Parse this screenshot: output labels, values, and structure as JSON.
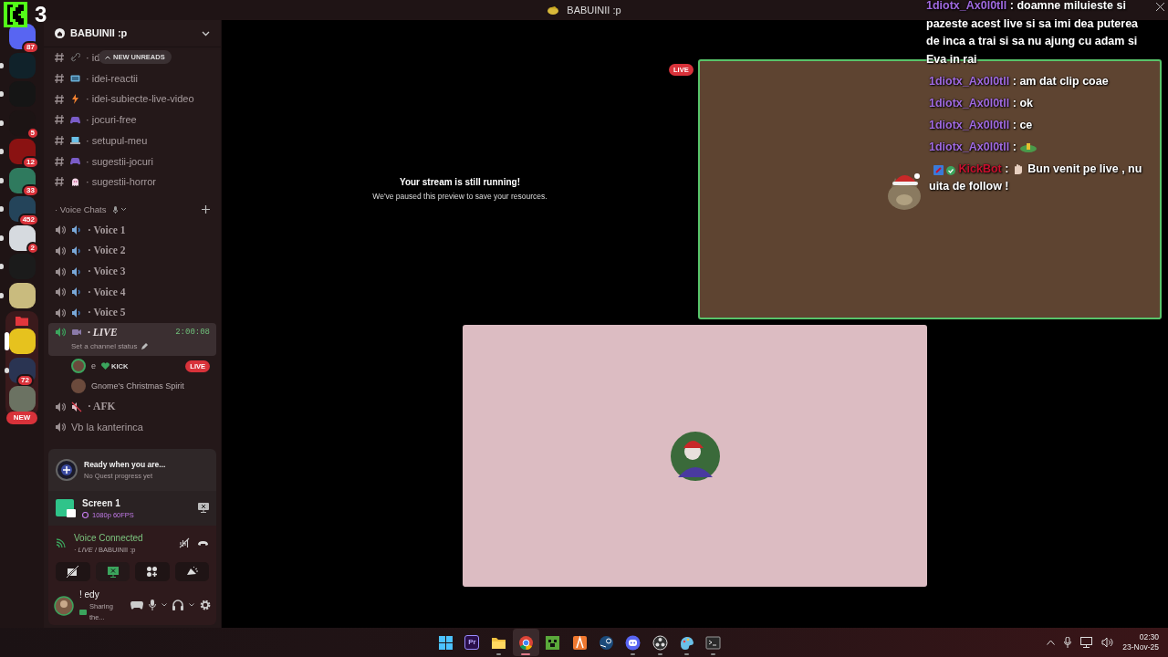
{
  "title_bar": {
    "title": "BABUINII :p"
  },
  "stream_logo": {
    "count": "3"
  },
  "servers": [
    {
      "badge": "87",
      "unread": false,
      "color": "#5865f2"
    },
    {
      "unread": true,
      "color": "#10222a"
    },
    {
      "unread": true,
      "color": "#151515"
    },
    {
      "badge": "5",
      "unread": true,
      "color": "#1c1414"
    },
    {
      "badge": "12",
      "unread": true,
      "color": "#8a1212"
    },
    {
      "badge": "33",
      "unread": true,
      "color": "#2f7a5e"
    },
    {
      "badge": "452",
      "unread": true,
      "color": "#24445a"
    },
    {
      "badge": "2",
      "unread": true,
      "color": "#d6dadf"
    },
    {
      "unread": true,
      "color": "#1b1b1b"
    },
    {
      "unread": true,
      "color": "#c9bb7e"
    }
  ],
  "folder": {
    "expanded": true,
    "servers": [
      {
        "unread": false,
        "selected": true,
        "color": "#e6c21e"
      },
      {
        "badge": "72",
        "unread": true,
        "selected": false,
        "color": "#2a3452"
      },
      {
        "unread": false,
        "selected": false,
        "color": "#6b7262"
      }
    ]
  },
  "new_badge": "NEW",
  "server_header": {
    "name": "BABUINII :p"
  },
  "new_unreads": "NEW UNREADS",
  "text_channels": [
    {
      "name": "· id"
    },
    {
      "name": "· idei-reactii"
    },
    {
      "name": "· idei-subiecte-live-video"
    },
    {
      "name": "· jocuri-free"
    },
    {
      "name": "· setupul-meu"
    },
    {
      "name": "· sugestii-jocuri"
    },
    {
      "name": "· sugestii-horror"
    }
  ],
  "voice_category": {
    "name": "· Voice Chats",
    "expanded": true
  },
  "voice_channels": [
    {
      "name": "· Voice 1",
      "kind": "serif",
      "selected": false
    },
    {
      "name": "· Voice 2",
      "kind": "serif",
      "selected": false
    },
    {
      "name": "· Voice 3",
      "kind": "serif",
      "selected": false
    },
    {
      "name": "· Voice 4",
      "kind": "serif",
      "selected": false
    },
    {
      "name": "· Voice 5",
      "kind": "serif",
      "selected": false
    },
    {
      "name": "· LIVE",
      "kind": "serif_italic",
      "selected": true,
      "timer": "2:00:08",
      "status": "Set a channel status",
      "members": [
        {
          "name": "e",
          "tag": "KICK",
          "badge": "LIVE",
          "speaking": true
        },
        {
          "name": "Gnome's Christmas Spirit",
          "speaking": false
        }
      ]
    },
    {
      "name": "· AFK",
      "kind": "serif",
      "selected": false
    },
    {
      "name": "Vb la kanterinca",
      "kind": "plain",
      "selected": false
    }
  ],
  "quest": {
    "title": "Ready when you are...",
    "subtitle": "No Quest progress yet"
  },
  "screen_share": {
    "title": "Screen 1",
    "quality": "1080p 60FPS"
  },
  "voice_status": {
    "status": "Voice Connected",
    "channel": "· *LIVE* / BABUINII :p"
  },
  "voice_buttons": [
    {
      "active": false
    },
    {
      "active": true
    },
    {
      "active": false
    },
    {
      "active": false
    }
  ],
  "user": {
    "name": "! edy",
    "status": "Sharing the..."
  },
  "stage": {
    "live_badge": "LIVE",
    "notice_title": "Your stream is still running!",
    "notice_text": "We've paused this preview to save your resources.",
    "tiles": [
      {
        "kind": "stream",
        "speaking": true
      },
      {
        "kind": "avatar",
        "speaking": false
      }
    ]
  },
  "chat": [
    {
      "user": "1diotx_Ax0l0tll",
      "separator": ":",
      "text": "doamne miluieste si pazeste acest live si sa imi dea puterea de inca a trai si sa nu ajung cu adam si Eva in rai",
      "color": "#a06ae0",
      "kind": "text"
    },
    {
      "user": "1diotx_Ax0l0tll",
      "separator": ":",
      "text": "am dat clip coae",
      "color": "#a06ae0",
      "kind": "text"
    },
    {
      "user": "1diotx_Ax0l0tll",
      "separator": ":",
      "text": "ok",
      "color": "#a06ae0",
      "kind": "text"
    },
    {
      "user": "1diotx_Ax0l0tll",
      "separator": ":",
      "text": "ce",
      "color": "#a06ae0",
      "kind": "text"
    },
    {
      "user": "1diotx_Ax0l0tll",
      "separator": ":",
      "color": "#a06ae0",
      "kind": "emote"
    },
    {
      "user": "KickBot",
      "separator": ":",
      "text": "Bun venit pe live , nu uita de follow !",
      "color": "#c8102e",
      "kind": "bot"
    }
  ],
  "taskbar": {
    "apps": [
      {
        "running": false,
        "active": false
      },
      {
        "label": "Pr",
        "running": false,
        "active": false
      },
      {
        "running": true,
        "active": false
      },
      {
        "running": true,
        "active": true
      },
      {
        "running": false,
        "active": false
      },
      {
        "running": false,
        "active": false
      },
      {
        "running": false,
        "active": false
      },
      {
        "running": true,
        "active": false
      },
      {
        "running": true,
        "active": false
      },
      {
        "running": true,
        "active": false
      },
      {
        "running": true,
        "active": false
      }
    ],
    "time": "02:30",
    "date": "23-Nov-25"
  }
}
